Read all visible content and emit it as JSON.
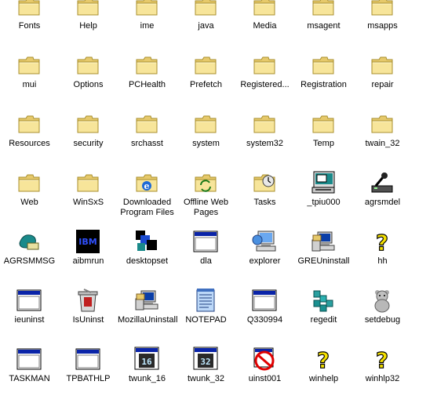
{
  "explorer_icons": [
    {
      "label": "Fonts",
      "icon": "folder-icon"
    },
    {
      "label": "Help",
      "icon": "folder-icon"
    },
    {
      "label": "ime",
      "icon": "folder-icon"
    },
    {
      "label": "java",
      "icon": "folder-icon"
    },
    {
      "label": "Media",
      "icon": "folder-icon"
    },
    {
      "label": "msagent",
      "icon": "folder-icon"
    },
    {
      "label": "msapps",
      "icon": "folder-icon"
    },
    {
      "label": "mui",
      "icon": "folder-icon"
    },
    {
      "label": "Options",
      "icon": "folder-icon"
    },
    {
      "label": "PCHealth",
      "icon": "folder-icon"
    },
    {
      "label": "Prefetch",
      "icon": "folder-icon"
    },
    {
      "label": "Registered...",
      "icon": "folder-icon"
    },
    {
      "label": "Registration",
      "icon": "folder-icon"
    },
    {
      "label": "repair",
      "icon": "folder-icon"
    },
    {
      "label": "Resources",
      "icon": "folder-icon"
    },
    {
      "label": "security",
      "icon": "folder-icon"
    },
    {
      "label": "srchasst",
      "icon": "folder-icon"
    },
    {
      "label": "system",
      "icon": "folder-icon"
    },
    {
      "label": "system32",
      "icon": "folder-icon"
    },
    {
      "label": "Temp",
      "icon": "folder-icon"
    },
    {
      "label": "twain_32",
      "icon": "folder-icon"
    },
    {
      "label": "Web",
      "icon": "folder-icon"
    },
    {
      "label": "WinSxS",
      "icon": "folder-icon"
    },
    {
      "label": "Downloaded Program Files",
      "icon": "ie-folder-icon"
    },
    {
      "label": "Offline Web Pages",
      "icon": "sync-folder-icon"
    },
    {
      "label": "Tasks",
      "icon": "tasks-folder-icon"
    },
    {
      "label": "_tpiu000",
      "icon": "setup-computer-icon"
    },
    {
      "label": "agrsmdel",
      "icon": "modem-icon"
    },
    {
      "label": "AGRSMMSG",
      "icon": "modem-message-icon"
    },
    {
      "label": "aibmrun",
      "icon": "ibm-logo-icon"
    },
    {
      "label": "desktopset",
      "icon": "desktop-set-icon"
    },
    {
      "label": "dla",
      "icon": "window-app-icon"
    },
    {
      "label": "explorer",
      "icon": "explorer-computer-icon"
    },
    {
      "label": "GREUninstall",
      "icon": "uninstall-computer-icon"
    },
    {
      "label": "hh",
      "icon": "help-question-icon"
    },
    {
      "label": "ieuninst",
      "icon": "window-app-icon"
    },
    {
      "label": "IsUninst",
      "icon": "recycle-bin-icon"
    },
    {
      "label": "MozillaUninstall",
      "icon": "uninstall-computer-icon"
    },
    {
      "label": "NOTEPAD",
      "icon": "notepad-icon"
    },
    {
      "label": "Q330994",
      "icon": "window-app-icon"
    },
    {
      "label": "regedit",
      "icon": "registry-cubes-icon"
    },
    {
      "label": "setdebug",
      "icon": "bear-icon"
    },
    {
      "label": "TASKMAN",
      "icon": "window-app-icon"
    },
    {
      "label": "TPBATHLP",
      "icon": "window-app-icon"
    },
    {
      "label": "twunk_16",
      "icon": "twain16-icon",
      "badge": "16"
    },
    {
      "label": "twunk_32",
      "icon": "twain32-icon",
      "badge": "32"
    },
    {
      "label": "uinst001",
      "icon": "no-entry-icon"
    },
    {
      "label": "winhelp",
      "icon": "help-question-icon"
    },
    {
      "label": "winhlp32",
      "icon": "help-question-icon"
    }
  ]
}
